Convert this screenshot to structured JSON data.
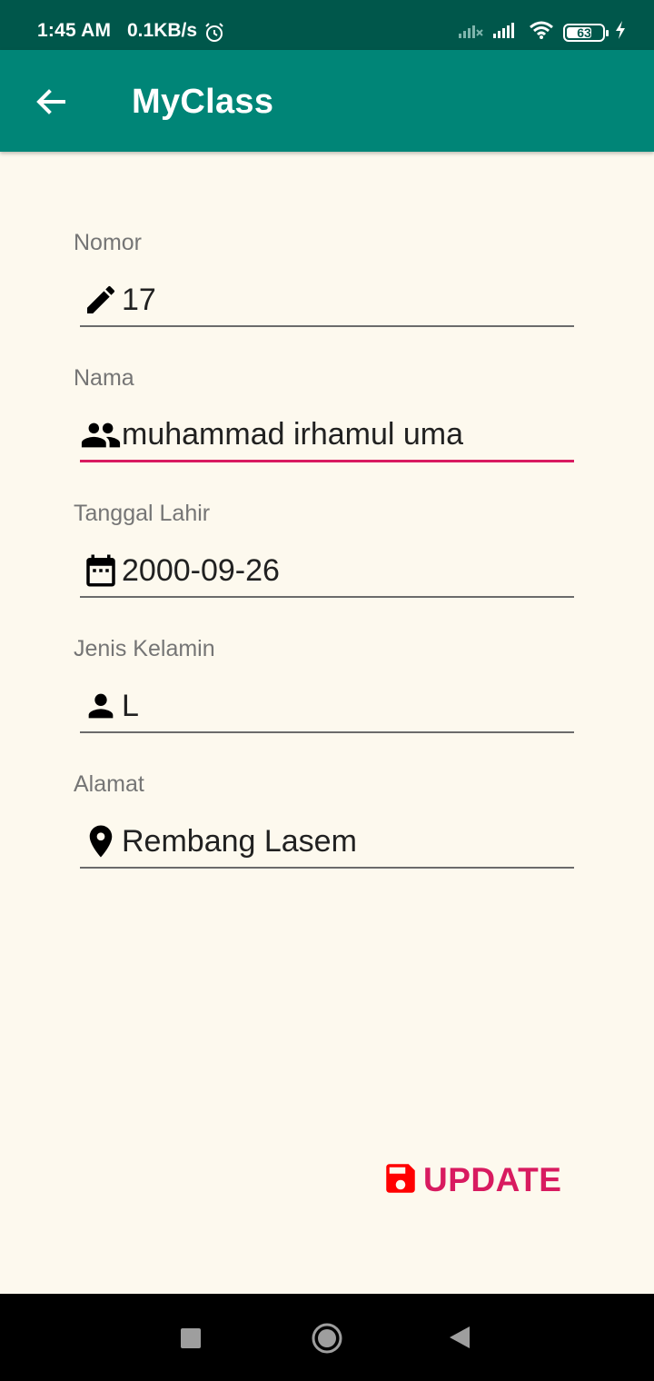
{
  "status_bar": {
    "time": "1:45 AM",
    "speed": "0.1KB/s",
    "battery": "63",
    "icons": [
      "alarm-icon",
      "signal-off-icon",
      "signal-icon",
      "wifi-icon",
      "battery-icon",
      "charging-icon"
    ]
  },
  "app_bar": {
    "title": "MyClass",
    "back_icon": "arrow-left-icon",
    "color": "#008577"
  },
  "form": {
    "fields": [
      {
        "label": "Nomor",
        "value": "17",
        "icon": "pencil-icon"
      },
      {
        "label": "Nama",
        "value": "muhammad irhamul uma",
        "icon": "people-icon",
        "focused": true
      },
      {
        "label": "Tanggal Lahir",
        "value": "2000-09-26",
        "icon": "calendar-icon"
      },
      {
        "label": "Jenis Kelamin",
        "value": "L",
        "icon": "person-icon"
      },
      {
        "label": "Alamat",
        "value": "Rembang Lasem",
        "icon": "location-pin-icon"
      }
    ]
  },
  "actions": {
    "update_label": "UPDATE",
    "update_icon": "save-icon",
    "accent_color": "#d81b60"
  },
  "nav_bar": {
    "icons": [
      "recents-icon",
      "home-icon",
      "back-icon"
    ]
  }
}
